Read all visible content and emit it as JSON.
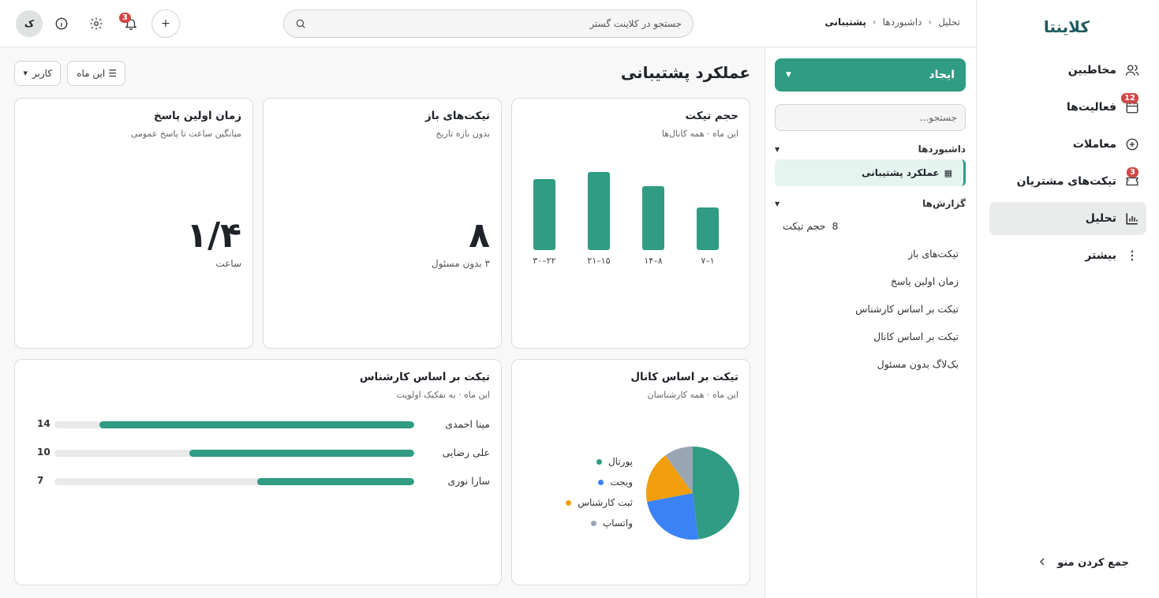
{
  "brand": "کلاینتا",
  "nav": [
    {
      "label": "مخاطبین",
      "icon": "users-icon",
      "badge": null
    },
    {
      "label": "فعالیت‌ها",
      "icon": "calendar-icon",
      "badge": "12"
    },
    {
      "label": "معاملات",
      "icon": "plus-circle-icon",
      "badge": null
    },
    {
      "label": "تیکت‌های مشتریان",
      "icon": "ticket-icon",
      "badge": "3"
    },
    {
      "label": "تحلیل",
      "icon": "bar-chart-icon",
      "badge": null
    },
    {
      "label": "بیشتر",
      "icon": "more-vertical-icon",
      "badge": null
    }
  ],
  "collapse_label": "جمع کردن منو",
  "breadcrumb": [
    "تحلیل",
    "داشبوردها",
    "پشتیبانی"
  ],
  "search_placeholder": "جستجو در کلاینت گستر",
  "avatar_letter": "ک",
  "notifications_count": "3",
  "panel": {
    "create_label": "ایجاد",
    "search_placeholder": "جستجو...",
    "dashboards_heading": "داشبوردها",
    "active_dashboard": "عملکرد پشتیبانی",
    "reports_heading": "گزارش‌ها",
    "reports": [
      {
        "label": "حجم تیکت",
        "count": "8"
      },
      {
        "label": "تیکت‌های باز"
      },
      {
        "label": "زمان اولین پاسخ"
      },
      {
        "label": "تیکت بر اساس کارشناس"
      },
      {
        "label": "تیکت بر اساس کانال"
      },
      {
        "label": "بک‌لاگ بدون مسئول"
      }
    ]
  },
  "page_title": "عملکرد پشتیبانی",
  "filters": {
    "period": "این ماه",
    "user": "کاربر"
  },
  "cards": {
    "volume": {
      "title": "حجم تیکت",
      "subtitle": "این ماه · همه کانال‌ها"
    },
    "open": {
      "title": "تیکت‌های باز",
      "subtitle": "بدون بازه تاریخ",
      "value": "۸",
      "note": "۳ بدون مسئول"
    },
    "first_response": {
      "title": "زمان اولین پاسخ",
      "subtitle": "میانگین ساعت تا پاسخ عمومی",
      "value": "۱/۴",
      "unit": "ساعت"
    },
    "channel": {
      "title": "تیکت بر اساس کانال",
      "subtitle": "این ماه · همه کارشناسان"
    },
    "agent": {
      "title": "تیکت بر اساس کارشناس",
      "subtitle": "این ماه · به تفکیک اولویت"
    }
  },
  "chart_data": [
    {
      "type": "bar",
      "title": "حجم تیکت",
      "categories": [
        "۱–۷",
        "۸–۱۴",
        "۱۵–۲۱",
        "۲۲–۳۰"
      ],
      "values": [
        6,
        9,
        11,
        10
      ],
      "ylim": [
        0,
        12
      ],
      "color": "#2f9c83"
    },
    {
      "type": "pie",
      "title": "تیکت بر اساس کانال",
      "labels": [
        "پورتال",
        "ویجت",
        "ثبت کارشناس",
        "واتساپ"
      ],
      "values": [
        48,
        24,
        18,
        10
      ],
      "colors": [
        "#2f9c83",
        "#3b82f6",
        "#f29e0c",
        "#9aa5b4"
      ]
    },
    {
      "type": "bar",
      "title": "تیکت بر اساس کارشناس",
      "categories": [
        "مینا احمدی",
        "علی رضایی",
        "سارا نوری"
      ],
      "values": [
        14,
        10,
        7
      ],
      "xlim": [
        0,
        16
      ],
      "color": "#2f9c83"
    }
  ]
}
